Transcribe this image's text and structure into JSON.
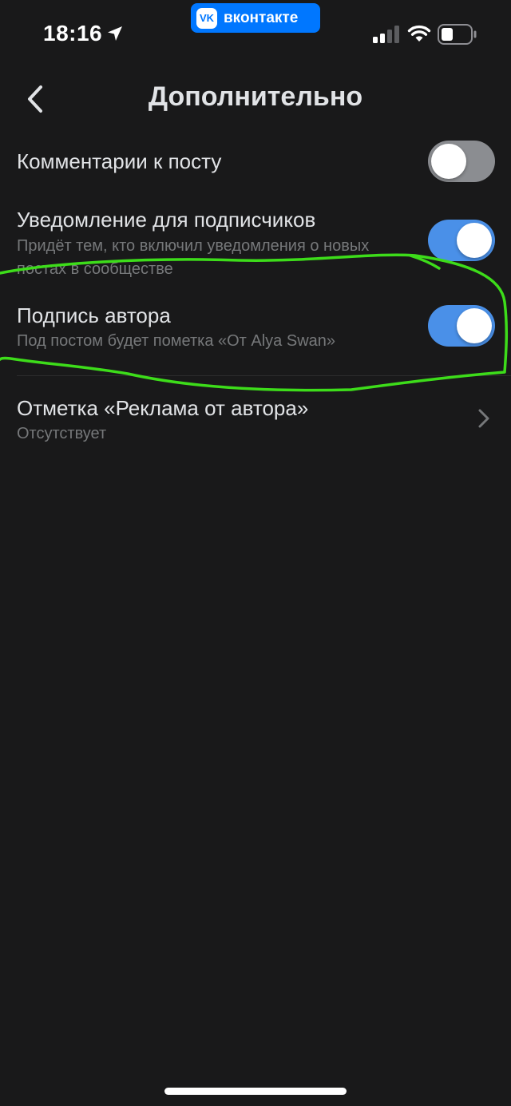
{
  "status_bar": {
    "time": "18:16",
    "location_icon": "location-arrow-icon",
    "app_badge": "вконтакте",
    "app_logo_text": "VK",
    "signal_icon": "cellular-signal-icon",
    "wifi_icon": "wifi-icon",
    "battery_icon": "battery-icon"
  },
  "nav": {
    "back_icon": "chevron-left-icon",
    "title": "Дополнительно"
  },
  "settings": [
    {
      "title": "Комментарии к посту",
      "subtitle": "",
      "control": "toggle",
      "enabled": false
    },
    {
      "title": "Уведомление для подписчиков",
      "subtitle": "Придёт тем, кто включил уведомления о новых постах в сообществе",
      "control": "toggle",
      "enabled": true
    },
    {
      "title": "Подпись автора",
      "subtitle": "Под постом будет пометка «От Alya Swan»",
      "control": "toggle",
      "enabled": true
    },
    {
      "title": "Отметка «Реклама от автора»",
      "subtitle": "Отсутствует",
      "control": "chevron-right-icon"
    }
  ],
  "colors": {
    "background": "#19191a",
    "toggle_on": "#4a90e8",
    "toggle_off": "#8b8d91",
    "vk_blue": "#0077ff",
    "highlight_annotation": "#3ddc1a"
  }
}
